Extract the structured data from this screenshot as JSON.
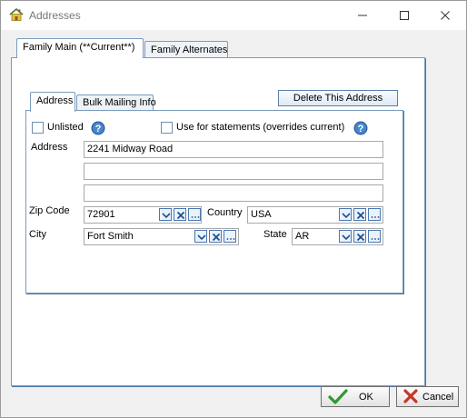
{
  "window": {
    "title": "Addresses"
  },
  "outer_tabs": [
    "Family Main (**Current**)",
    "Family Alternates"
  ],
  "inner_tabs": [
    "Address",
    "Bulk Mailing Info"
  ],
  "delete_button": "Delete This Address",
  "checkboxes": {
    "unlisted": "Unlisted",
    "statements": "Use for statements (overrides current)"
  },
  "labels": {
    "address": "Address",
    "zip": "Zip Code",
    "country": "Country",
    "city": "City",
    "state": "State"
  },
  "values": {
    "address1": "2241 Midway Road",
    "address2": "",
    "address3": "",
    "zip": "72901",
    "country": "USA",
    "city": "Fort Smith",
    "state": "AR"
  },
  "footer": {
    "ok": "OK",
    "cancel": "Cancel"
  },
  "colors": {
    "accent_blue": "#4a78b0",
    "ok_green": "#2e9a2e",
    "cancel_red": "#c0392b",
    "house_icon": "#d4a017"
  }
}
